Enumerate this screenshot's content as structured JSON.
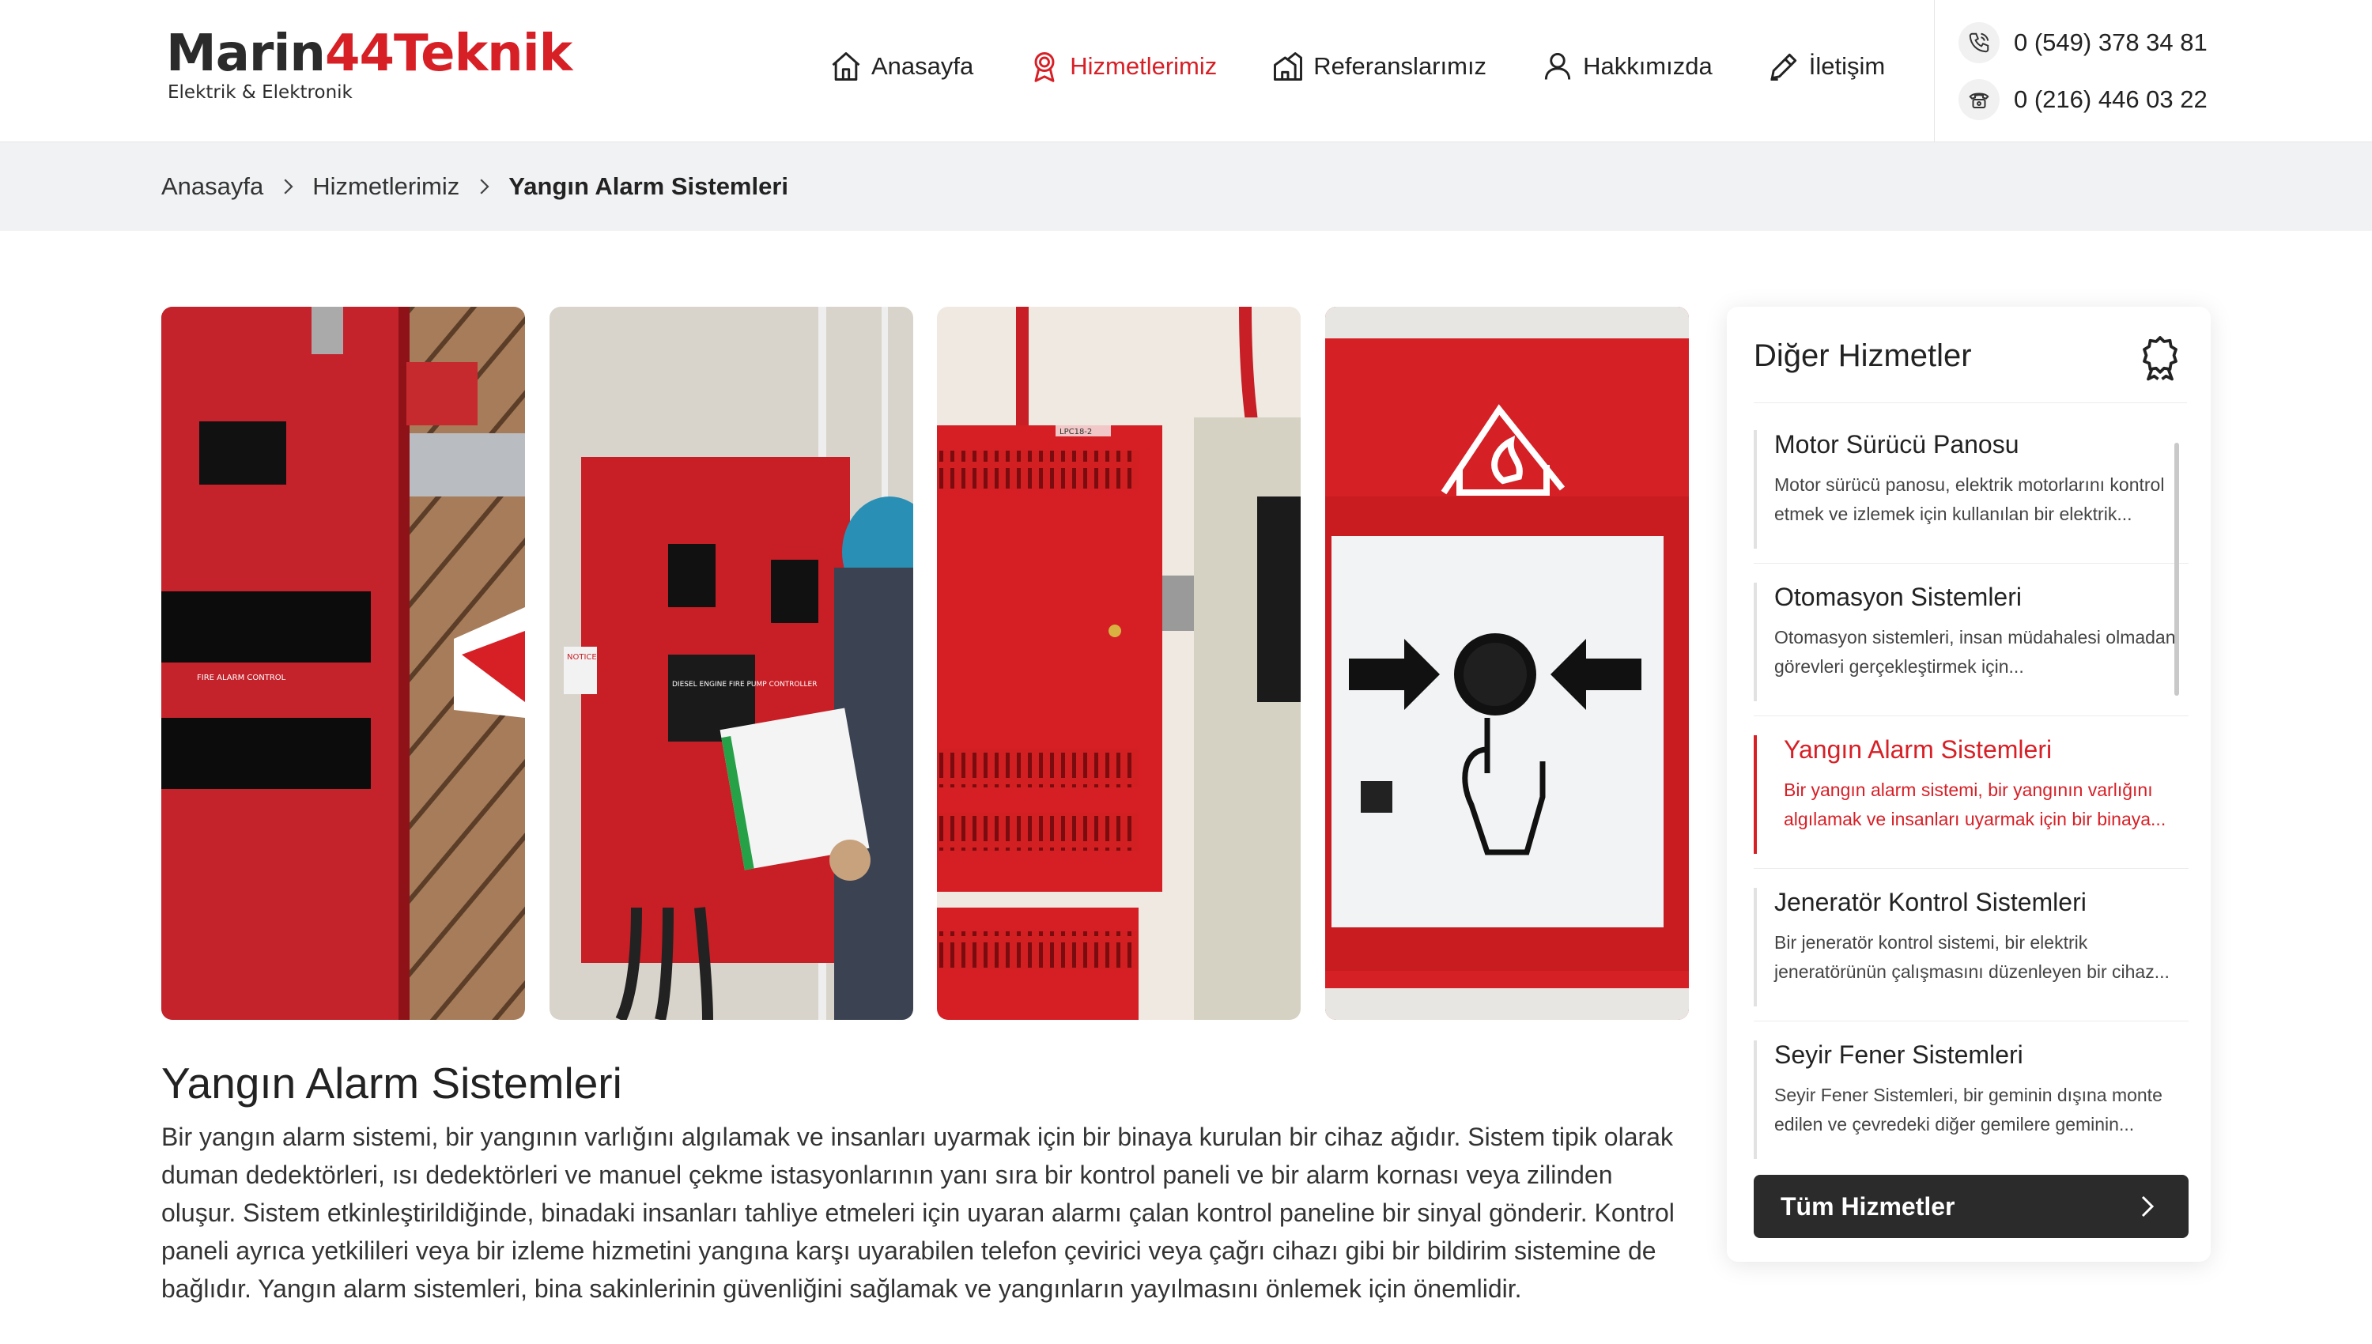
{
  "brand": {
    "name_dark": "Marin",
    "name_red": "44Teknik",
    "tagline": "Elektrik & Elektronik"
  },
  "nav": [
    {
      "label": "Anasayfa",
      "icon": "home-icon"
    },
    {
      "label": "Hizmetlerimiz",
      "icon": "award-icon"
    },
    {
      "label": "Referanslarımız",
      "icon": "building-icon"
    },
    {
      "label": "Hakkımızda",
      "icon": "user-icon"
    },
    {
      "label": "İletişim",
      "icon": "pen-icon"
    }
  ],
  "contact": {
    "mobile": "0 (549) 378 34 81",
    "landline": "0 (216) 446 03 22"
  },
  "breadcrumb": {
    "home": "Anasayfa",
    "section": "Hizmetlerimiz",
    "current": "Yangın Alarm Sistemleri"
  },
  "article": {
    "title": "Yangın Alarm Sistemleri",
    "body": "Bir yangın alarm sistemi, bir yangının varlığını algılamak ve insanları uyarmak için bir binaya kurulan bir cihaz ağıdır. Sistem tipik olarak duman dedektörleri, ısı dedektörleri ve manuel çekme istasyonlarının yanı sıra bir kontrol paneli ve bir alarm kornası veya zilinden oluşur. Sistem etkinleştirildiğinde, binadaki insanları tahliye etmeleri için uyaran alarmı çalan kontrol paneline bir sinyal gönderir. Kontrol paneli ayrıca yetkilileri veya bir izleme hizmetini yangına karşı uyarabilen telefon çevirici veya çağrı cihazı gibi bir bildirim sistemine de bağlıdır. Yangın alarm sistemleri, bina sakinlerinin güvenliğini sağlamak ve yangınların yayılmasını önlemek için önemlidir."
  },
  "gallery": {
    "img1_label": "FIRE ALARM CONTROL",
    "img2_label": "DIESEL ENGINE FIRE PUMP CONTROLLER",
    "img2_notice": "NOTICE",
    "img3_label": "LPC18-2"
  },
  "sidebar": {
    "title": "Diğer Hizmetler",
    "items": [
      {
        "title": "Motor Sürücü Panosu",
        "desc": "Motor sürücü panosu, elektrik motorlarını kontrol etmek ve izlemek için kullanılan bir elektrik...",
        "active": false
      },
      {
        "title": "Otomasyon Sistemleri",
        "desc": "Otomasyon sistemleri, insan müdahalesi olmadan görevleri gerçekleştirmek için...",
        "active": false
      },
      {
        "title": "Yangın Alarm Sistemleri",
        "desc": "Bir yangın alarm sistemi, bir yangının varlığını algılamak ve insanları uyarmak için bir binaya...",
        "active": true
      },
      {
        "title": "Jeneratör Kontrol Sistemleri",
        "desc": "Bir jeneratör kontrol sistemi, bir elektrik jeneratörünün çalışmasını düzenleyen bir cihaz...",
        "active": false
      },
      {
        "title": "Seyir Fener Sistemleri",
        "desc": "Seyir Fener Sistemleri, bir geminin dışına monte edilen ve çevredeki diğer gemilere geminin...",
        "active": false
      }
    ],
    "button_label": "Tüm Hizmetler"
  },
  "colors": {
    "accent": "#d71f26",
    "dark": "#2b2b2b",
    "crumb_bg": "#f1f2f4"
  }
}
